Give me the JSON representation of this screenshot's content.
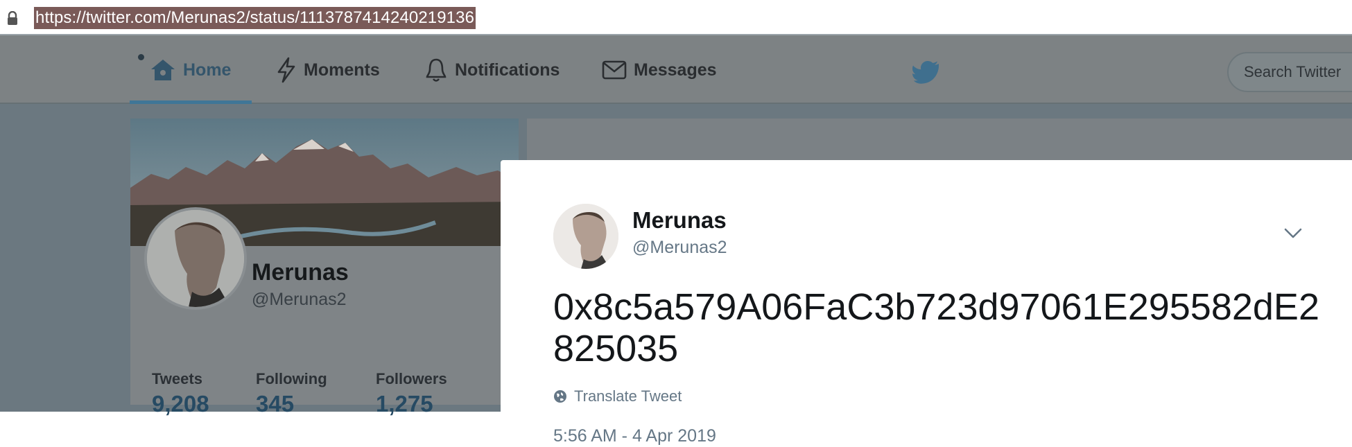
{
  "browser": {
    "url": "https://twitter.com/Merunas2/status/1113787414240219136"
  },
  "nav": {
    "home": "Home",
    "moments": "Moments",
    "notifications": "Notifications",
    "messages": "Messages",
    "search_placeholder": "Search Twitter"
  },
  "profile": {
    "name": "Merunas",
    "handle": "@Merunas2",
    "stats": [
      {
        "label": "Tweets",
        "value": "9,208"
      },
      {
        "label": "Following",
        "value": "345"
      },
      {
        "label": "Followers",
        "value": "1,275"
      }
    ]
  },
  "tweet": {
    "author_name": "Merunas",
    "author_handle": "@Merunas2",
    "text": "0x8c5a579A06FaC3b723d97061E295582dE2825035",
    "translate_label": "Translate Tweet",
    "timestamp": "5:56 AM - 4 Apr 2019"
  },
  "colors": {
    "accent": "#3f7697",
    "modal_bg": "#ffffff",
    "overlay": "#6b7880"
  }
}
